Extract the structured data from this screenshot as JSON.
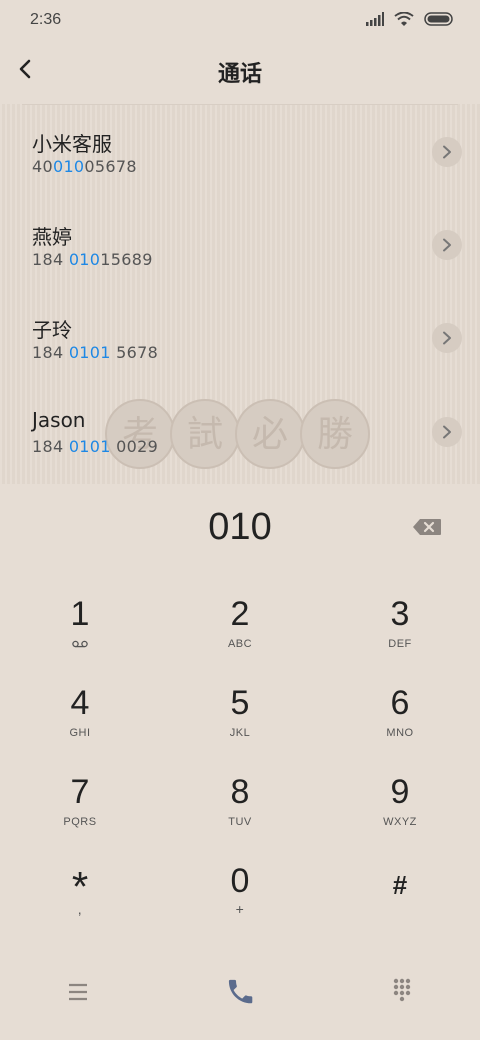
{
  "status": {
    "time": "2:36"
  },
  "header": {
    "title": "通话"
  },
  "contacts": [
    {
      "name": "小米客服",
      "num_pre": "40",
      "num_hl": "010",
      "num_post": "05678"
    },
    {
      "name": "燕婷",
      "num_pre": "184 ",
      "num_hl": "010",
      "num_post": "15689"
    },
    {
      "name": "子玲",
      "num_pre": "184 ",
      "num_hl": "0101",
      "num_post": " 5678"
    },
    {
      "name": "Jason",
      "num_pre": "184 ",
      "num_hl": "0101",
      "num_post": " 0029"
    }
  ],
  "wallpaper_stamp": [
    "考",
    "試",
    "必",
    "勝"
  ],
  "dialer": {
    "input": "010"
  },
  "keypad": [
    {
      "digit": "1",
      "sub": ""
    },
    {
      "digit": "2",
      "sub": "ABC"
    },
    {
      "digit": "3",
      "sub": "DEF"
    },
    {
      "digit": "4",
      "sub": "GHI"
    },
    {
      "digit": "5",
      "sub": "JKL"
    },
    {
      "digit": "6",
      "sub": "MNO"
    },
    {
      "digit": "7",
      "sub": "PQRS"
    },
    {
      "digit": "8",
      "sub": "TUV"
    },
    {
      "digit": "9",
      "sub": "WXYZ"
    },
    {
      "digit": "*",
      "sub": ","
    },
    {
      "digit": "0",
      "sub": "+"
    },
    {
      "digit": "#",
      "sub": ""
    }
  ],
  "icons": {
    "back": "back-arrow-icon",
    "chevron": "chevron-right-icon",
    "backspace": "backspace-icon",
    "menu": "menu-icon",
    "call": "phone-icon",
    "dialpad": "dialpad-icon",
    "voicemail": "voicemail-icon"
  },
  "colors": {
    "highlight": "#1e88e5",
    "call": "#5b6b8c",
    "background": "#e6ddd4"
  }
}
